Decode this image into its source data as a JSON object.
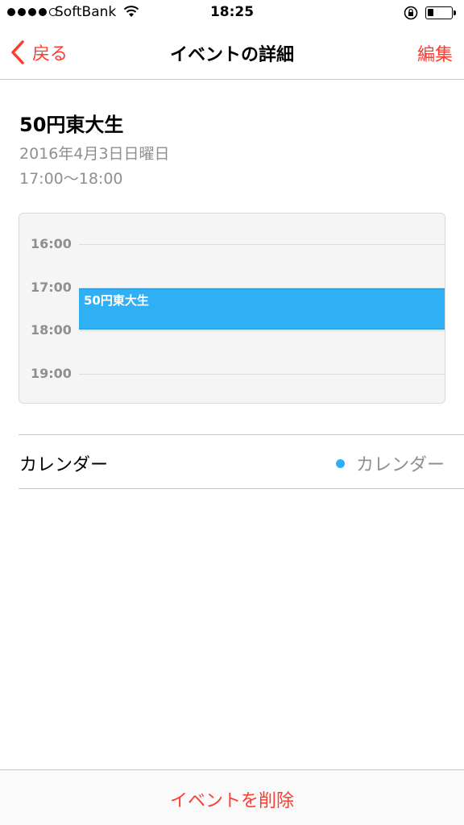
{
  "status_bar": {
    "carrier": "SoftBank",
    "time": "18:25",
    "signal_bars_filled": 4,
    "signal_bars_total": 5,
    "battery_level": 0.2
  },
  "nav": {
    "back_label": "戻る",
    "title": "イベントの詳細",
    "edit_label": "編集"
  },
  "event": {
    "title": "50円東大生",
    "date": "2016年4月3日日曜日",
    "time_range": "17:00〜18:00"
  },
  "timeline": {
    "hours": [
      "16:00",
      "17:00",
      "18:00",
      "19:00"
    ],
    "event_label": "50円東大生",
    "event_color": "#2fb0f5"
  },
  "calendar_row": {
    "label": "カレンダー",
    "value": "カレンダー",
    "dot_color": "#2fb0f5"
  },
  "toolbar": {
    "delete_label": "イベントを削除"
  },
  "colors": {
    "accent": "#ff3b30",
    "secondary_text": "#8e8e93"
  },
  "icons": [
    "signal-dots-icon",
    "wifi-icon",
    "rotation-lock-icon",
    "battery-icon",
    "chevron-left-icon"
  ]
}
